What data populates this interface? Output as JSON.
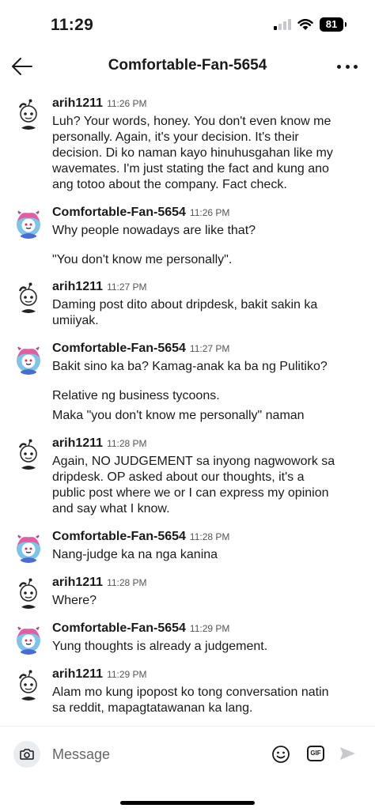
{
  "status_bar": {
    "time": "11:29",
    "battery": "81"
  },
  "header": {
    "title": "Comfortable-Fan-5654"
  },
  "messages": [
    {
      "author": "arih1211",
      "time": "11:26 PM",
      "lines": [
        "Luh? Your words, honey. You don't even know me",
        "personally. Again, it's your decision. It's their",
        "decision. Di ko naman kayo hinuhusgahan like my",
        "wavemates. I'm just stating the fact and kung ano",
        "ang totoo about the company. Fact check."
      ]
    },
    {
      "author": "Comfortable-Fan-5654",
      "time": "11:26 PM",
      "lines": [
        "Why people nowadays are like that?"
      ],
      "extra": "\"You don't know me personally\"."
    },
    {
      "author": "arih1211",
      "time": "11:27 PM",
      "lines": [
        "Daming post dito about dripdesk, bakit sakin ka",
        "umiiyak."
      ]
    },
    {
      "author": "Comfortable-Fan-5654",
      "time": "11:27 PM",
      "lines": [
        "Bakit sino ka ba? Kamag-anak ka ba ng Pulitiko?"
      ],
      "extra": "Relative ng business tycoons.",
      "extra2": "Maka \"you don't know me personally\" naman"
    },
    {
      "author": "arih1211",
      "time": "11:28 PM",
      "lines": [
        "Again, NO JUDGEMENT sa inyong nagwowork sa",
        "dripdesk. OP asked about our thoughts, it's a",
        "public post where we or I can express my opinion",
        "and say what I know."
      ]
    },
    {
      "author": "Comfortable-Fan-5654",
      "time": "11:28 PM",
      "lines": [
        "Nang-judge ka na nga kanina"
      ]
    },
    {
      "author": "arih1211",
      "time": "11:28 PM",
      "lines": [
        "Where?"
      ]
    },
    {
      "author": "Comfortable-Fan-5654",
      "time": "11:29 PM",
      "lines": [
        "Yung thoughts is already a judgement."
      ]
    },
    {
      "author": "arih1211",
      "time": "11:29 PM",
      "lines": [
        "Alam mo kung ipopost ko tong conversation natin",
        "sa reddit, mapagtatawanan ka lang."
      ]
    }
  ],
  "composer": {
    "placeholder": "Message",
    "gif_label": "GIF"
  }
}
